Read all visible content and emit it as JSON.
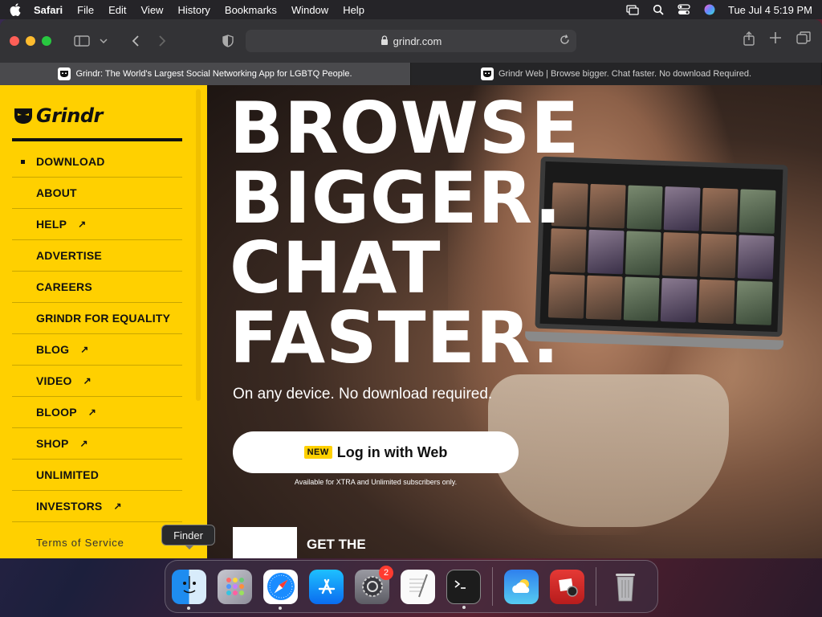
{
  "menubar": {
    "app": "Safari",
    "items": [
      "File",
      "Edit",
      "View",
      "History",
      "Bookmarks",
      "Window",
      "Help"
    ],
    "datetime": "Tue Jul 4  5:19 PM",
    "icons": [
      "apple-icon",
      "screen-mirror-icon",
      "spotlight-icon",
      "control-center-icon",
      "siri-icon"
    ]
  },
  "browser": {
    "url": "grindr.com",
    "tabs": [
      {
        "title": "Grindr: The World's Largest Social Networking App for LGBTQ People."
      },
      {
        "title": "Grindr Web | Browse bigger. Chat faster. No download Required."
      }
    ]
  },
  "sidebar": {
    "logo": "Grindr",
    "items": [
      {
        "label": "DOWNLOAD",
        "external": false,
        "active": true
      },
      {
        "label": "ABOUT",
        "external": false
      },
      {
        "label": "HELP",
        "external": true
      },
      {
        "label": "ADVERTISE",
        "external": false
      },
      {
        "label": "CAREERS",
        "external": false
      },
      {
        "label": "GRINDR FOR EQUALITY",
        "external": false
      },
      {
        "label": "BLOG",
        "external": true
      },
      {
        "label": "VIDEO",
        "external": true
      },
      {
        "label": "BLOOP",
        "external": true
      },
      {
        "label": "SHOP",
        "external": true
      },
      {
        "label": "UNLIMITED",
        "external": false
      },
      {
        "label": "INVESTORS",
        "external": true
      }
    ],
    "terms": "Terms of Service",
    "external_arrow": "↗"
  },
  "hero": {
    "headline": [
      "BROWSE",
      "BIGGER.",
      "CHAT",
      "FASTER."
    ],
    "subhead": "On any device. No download required.",
    "login_badge": "NEW",
    "login_label": "Log in with Web",
    "availability": "Available for XTRA and Unlimited subscribers only.",
    "promo_text": "GET THE"
  },
  "tooltip": "Finder",
  "dock": {
    "apps": [
      {
        "name": "Finder",
        "running": true
      },
      {
        "name": "Launchpad",
        "running": false
      },
      {
        "name": "Safari",
        "running": true
      },
      {
        "name": "App Store",
        "running": false
      },
      {
        "name": "System Settings",
        "running": false,
        "badge": "2"
      },
      {
        "name": "TextEdit",
        "running": false
      },
      {
        "name": "Terminal",
        "running": true
      },
      {
        "name": "Weather",
        "running": false
      },
      {
        "name": "Photo Booth",
        "running": false
      },
      {
        "name": "Trash",
        "running": false
      }
    ]
  },
  "colors": {
    "brand_yellow": "#ffd000",
    "menubar": "#252428"
  }
}
